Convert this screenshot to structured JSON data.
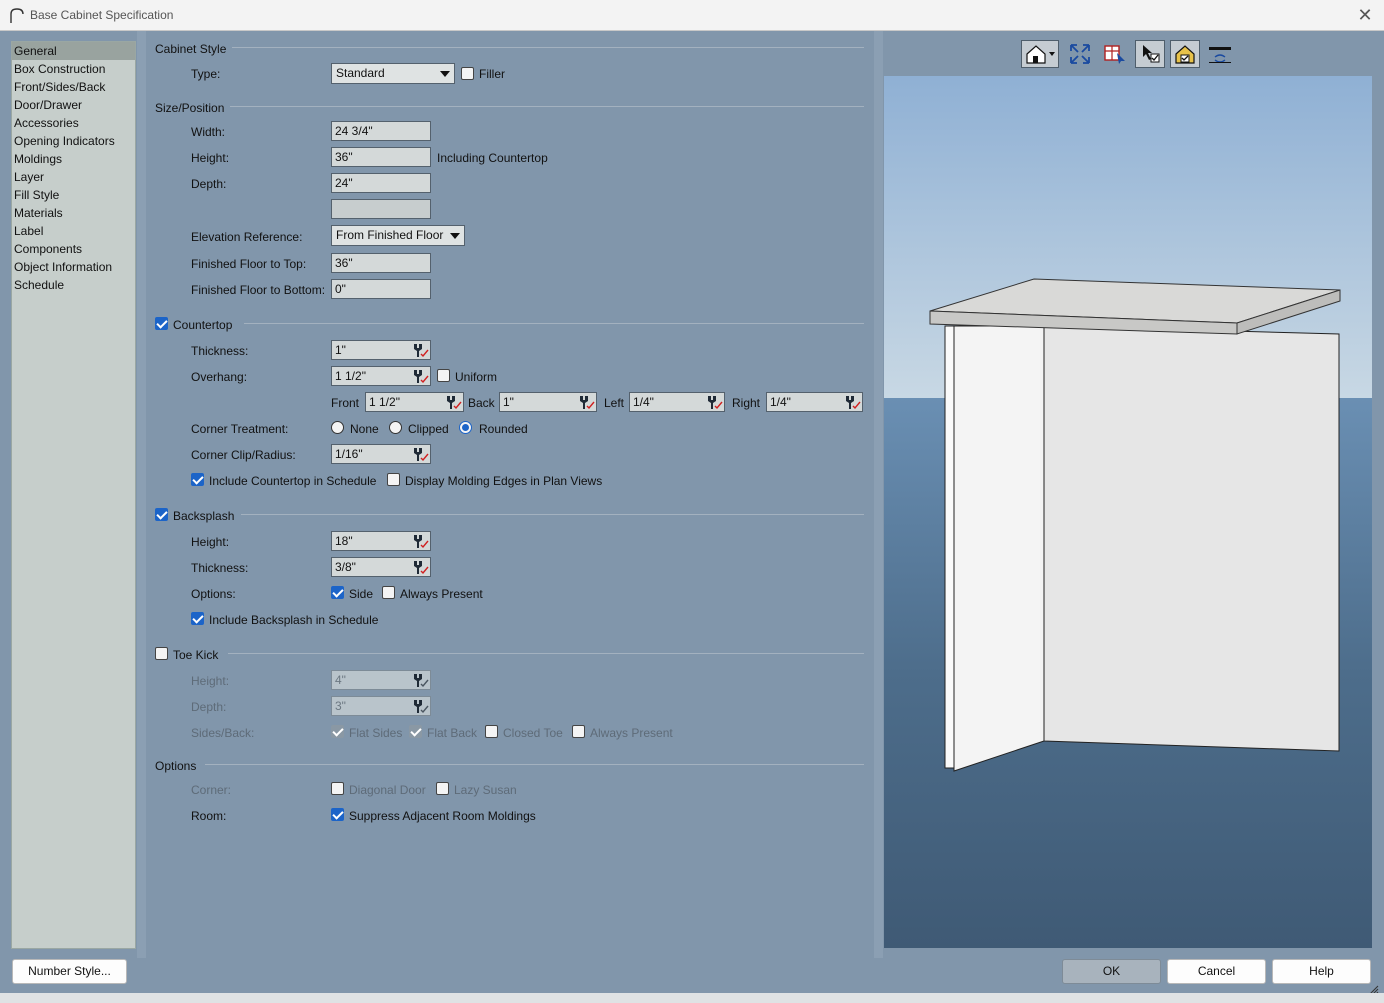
{
  "window": {
    "title": "Base Cabinet Specification"
  },
  "nav": {
    "items": [
      "General",
      "Box Construction",
      "Front/Sides/Back",
      "Door/Drawer",
      "Accessories",
      "Opening Indicators",
      "Moldings",
      "Layer",
      "Fill Style",
      "Materials",
      "Label",
      "Components",
      "Object Information",
      "Schedule"
    ],
    "selected": "General"
  },
  "cabinet_style": {
    "header": "Cabinet Style",
    "type_label": "Type:",
    "type_value": "Standard",
    "filler_label": "Filler"
  },
  "size_position": {
    "header": "Size/Position",
    "width_label": "Width:",
    "width_value": "24 3/4\"",
    "height_label": "Height:",
    "height_value": "36\"",
    "height_note": "Including Countertop",
    "depth_label": "Depth:",
    "depth_value": "24\"",
    "elev_ref_label": "Elevation Reference:",
    "elev_ref_value": "From Finished Floor",
    "ff_top_label": "Finished Floor to Top:",
    "ff_top_value": "36\"",
    "ff_bottom_label": "Finished Floor to Bottom:",
    "ff_bottom_value": "0\""
  },
  "countertop": {
    "header": "Countertop",
    "thickness_label": "Thickness:",
    "thickness_value": "1\"",
    "overhang_label": "Overhang:",
    "overhang_value": "1 1/2\"",
    "uniform_label": "Uniform",
    "front_label": "Front",
    "front_value": "1 1/2\"",
    "back_label": "Back",
    "back_value": "1\"",
    "left_label": "Left",
    "left_value": "1/4\"",
    "right_label": "Right",
    "right_value": "1/4\"",
    "corner_label": "Corner Treatment:",
    "corner_none": "None",
    "corner_clipped": "Clipped",
    "corner_rounded": "Rounded",
    "clip_label": "Corner Clip/Radius:",
    "clip_value": "1/16\"",
    "include_label": "Include Countertop in Schedule",
    "molding_label": "Display Molding Edges in Plan Views"
  },
  "backsplash": {
    "header": "Backsplash",
    "height_label": "Height:",
    "height_value": "18\"",
    "thickness_label": "Thickness:",
    "thickness_value": "3/8\"",
    "options_label": "Options:",
    "side_label": "Side",
    "always_label": "Always Present",
    "include_label": "Include Backsplash in Schedule"
  },
  "toe_kick": {
    "header": "Toe Kick",
    "height_label": "Height:",
    "height_value": "4\"",
    "depth_label": "Depth:",
    "depth_value": "3\"",
    "sidesback_label": "Sides/Back:",
    "flat_sides": "Flat Sides",
    "flat_back": "Flat Back",
    "closed_toe": "Closed Toe",
    "always_present": "Always Present"
  },
  "options": {
    "header": "Options",
    "corner_label": "Corner:",
    "diagonal_door": "Diagonal Door",
    "lazy_susan": "Lazy Susan",
    "room_label": "Room:",
    "suppress_label": "Suppress Adjacent Room Moldings"
  },
  "buttons": {
    "number_style": "Number Style...",
    "ok": "OK",
    "cancel": "Cancel",
    "help": "Help"
  },
  "colors": {
    "panel": "#8196ab",
    "nav_bg": "#c6cecb",
    "accent": "#1c64c8"
  }
}
